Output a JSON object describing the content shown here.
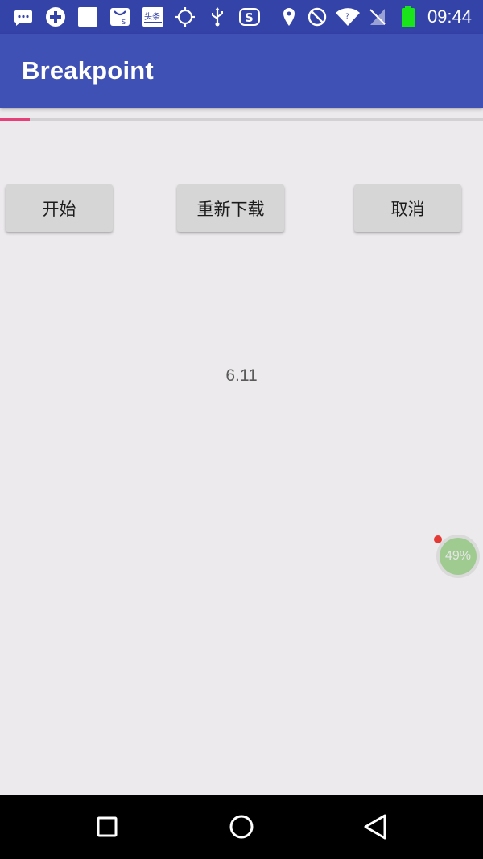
{
  "status_bar": {
    "time": "09:44",
    "left_icons": [
      "message-icon",
      "plus-circle-icon",
      "square-app-icon",
      "shopping-bag-icon",
      "toutiao-news-icon",
      "gps-target-icon",
      "usb-icon",
      "s-app-icon"
    ],
    "right_icons": [
      "location-icon",
      "do-not-disturb-icon",
      "wifi-icon",
      "no-sim-icon",
      "battery-icon"
    ],
    "colors": {
      "background": "#3443A8",
      "battery": "#1AE51A"
    },
    "toutiao_label": "头条"
  },
  "app_bar": {
    "title": "Breakpoint",
    "color": "#3F51B5"
  },
  "progress": {
    "value_fraction": 0.0611,
    "fill_color": "#E5407A"
  },
  "buttons": {
    "start": "开始",
    "redownload": "重新下载",
    "cancel": "取消"
  },
  "value_display": "6.11",
  "floating_widget": {
    "percent": "49%"
  },
  "nav_bar": {
    "icons": [
      "recent-apps-icon",
      "home-icon",
      "back-icon"
    ]
  }
}
